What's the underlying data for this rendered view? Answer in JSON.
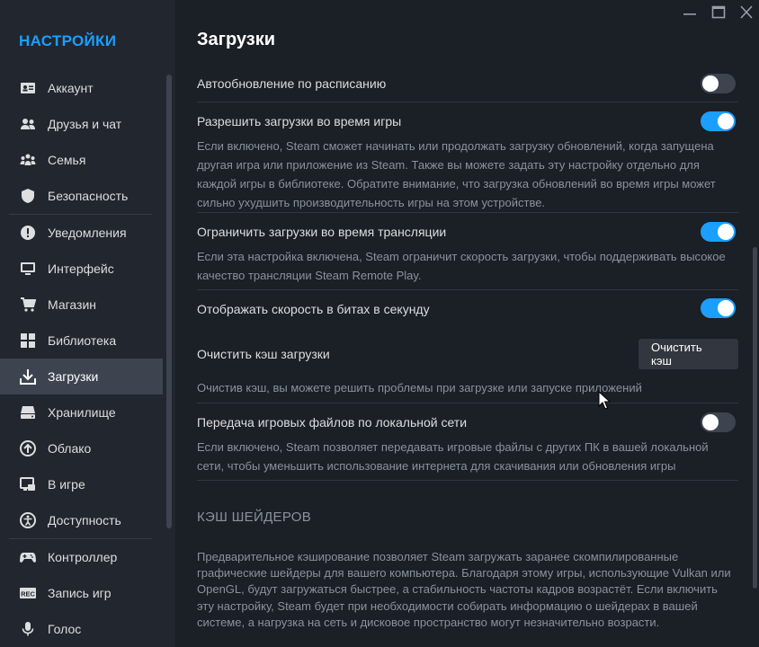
{
  "sidebar": {
    "title": "НАСТРОЙКИ",
    "items": [
      {
        "label": "Аккаунт",
        "icon": "id-card-icon"
      },
      {
        "label": "Друзья и чат",
        "icon": "friends-icon"
      },
      {
        "label": "Семья",
        "icon": "family-icon"
      },
      {
        "label": "Безопасность",
        "icon": "shield-icon"
      },
      {
        "label": "Уведомления",
        "icon": "alert-icon"
      },
      {
        "label": "Интерфейс",
        "icon": "monitor-icon"
      },
      {
        "label": "Магазин",
        "icon": "cart-icon"
      },
      {
        "label": "Библиотека",
        "icon": "grid-icon"
      },
      {
        "label": "Загрузки",
        "icon": "download-icon",
        "active": true
      },
      {
        "label": "Хранилище",
        "icon": "storage-icon"
      },
      {
        "label": "Облако",
        "icon": "cloud-icon"
      },
      {
        "label": "В игре",
        "icon": "ingame-icon"
      },
      {
        "label": "Доступность",
        "icon": "accessibility-icon"
      },
      {
        "label": "Контроллер",
        "icon": "gamepad-icon"
      },
      {
        "label": "Запись игр",
        "icon": "rec-icon"
      },
      {
        "label": "Голос",
        "icon": "microphone-icon"
      }
    ]
  },
  "page": {
    "title": "Загрузки"
  },
  "settings": {
    "auto_update": {
      "title": "Автообновление по расписанию",
      "enabled": false
    },
    "allow_during_game": {
      "title": "Разрешить загрузки во время игры",
      "enabled": true,
      "description": "Если включено, Steam сможет начинать или продолжать загрузку обновлений, когда запущена другая игра или приложение из Steam. Также вы можете задать эту настройку отдельно для каждой игры в библиотеке. Обратите внимание, что загрузка обновлений во время игры может сильно ухудшить производительность игры на этом устройстве."
    },
    "throttle_broadcast": {
      "title": "Ограничить загрузки во время трансляции",
      "enabled": true,
      "description": "Если эта настройка включена, Steam ограничит скорость загрузки, чтобы поддерживать высокое качество трансляции Steam Remote Play."
    },
    "bits_per_second": {
      "title": "Отображать скорость в битах в секунду",
      "enabled": true
    },
    "clear_cache": {
      "title": "Очистить кэш загрузки",
      "button_label": "Очистить кэш",
      "description": "Очистив кэш, вы можете решить проблемы при загрузке или запуске приложений"
    },
    "lan_transfer": {
      "title": "Передача игровых файлов по локальной сети",
      "enabled": false,
      "description": "Если включено, Steam позволяет передавать игровые файлы с других ПК в вашей локальной сети, чтобы уменьшить использование интернета для скачивания или обновления игры"
    }
  },
  "shader_section": {
    "header": "КЭШ ШЕЙДЕРОВ",
    "description": "Предварительное кэширование позволяет Steam загружать заранее скомпилированные графические шейдеры для вашего компьютера. Благодаря этому игры, использующие Vulkan или OpenGL, будут загружаться быстрее, а стабильность частоты кадров возрастёт. Если включить эту настройку, Steam будет при необходимости собирать информацию о шейдерах в вашей системе, а нагрузка на сеть и дисковое пространство могут незначительно возрасти."
  },
  "colors": {
    "accent": "#1a9fff",
    "background": "#1b1f26",
    "sidebar": "#22262e",
    "active_item": "#3d4450"
  }
}
